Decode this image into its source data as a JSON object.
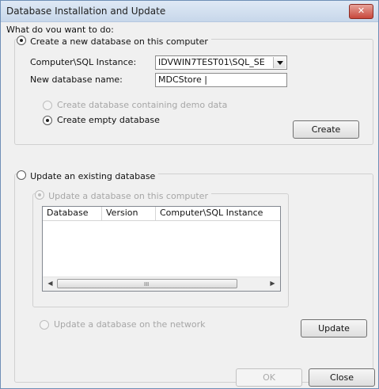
{
  "window": {
    "title": "Database Installation and Update",
    "close_glyph": "✕"
  },
  "prompt": "What do you want to do:",
  "create": {
    "radio_label": "Create a new database on this computer",
    "instance_label": "Computer\\SQL Instance:",
    "instance_value": "IDVWIN7TEST01\\SQL_SE",
    "name_label": "New database name:",
    "name_value": "MDCStore |",
    "demo_label": "Create database containing demo data",
    "empty_label": "Create empty database",
    "button": "Create"
  },
  "update": {
    "radio_label": "Update an existing database",
    "local_label": "Update a database on this computer",
    "columns": [
      "Database",
      "Version",
      "Computer\\SQL Instance"
    ],
    "rows": [],
    "scroll_grip": "III",
    "network_label": "Update a database on the network",
    "button": "Update"
  },
  "footer": {
    "ok": "OK",
    "close": "Close"
  }
}
